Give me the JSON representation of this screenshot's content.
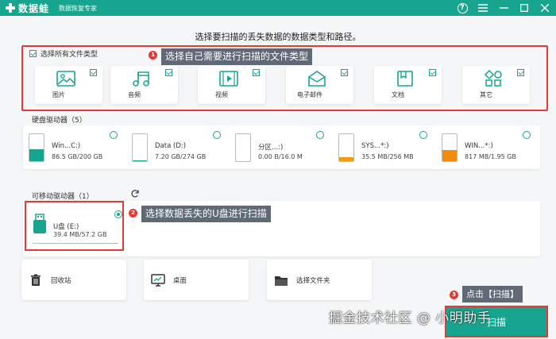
{
  "titlebar": {
    "app_name": "数据蛙",
    "subtitle": "数据恢复专家"
  },
  "headline": "选择要扫描的丢失数据的数据类型和路径。",
  "file_types": {
    "select_all": "选择所有文件类型",
    "items": [
      {
        "label": "图片",
        "icon": "image-icon",
        "checked": true
      },
      {
        "label": "音频",
        "icon": "music-icon",
        "checked": true
      },
      {
        "label": "视频",
        "icon": "video-icon",
        "checked": true
      },
      {
        "label": "电子邮件",
        "icon": "email-icon",
        "checked": true
      },
      {
        "label": "文档",
        "icon": "document-icon",
        "checked": true
      },
      {
        "label": "其它",
        "icon": "other-icon",
        "checked": true
      }
    ]
  },
  "annotations": [
    {
      "num": "1",
      "text": "选择自己需要进行扫描的文件类型"
    },
    {
      "num": "2",
      "text": "选择数据丢失的U盘进行扫描"
    },
    {
      "num": "3",
      "text": "点击【扫描】"
    }
  ],
  "hard_disks": {
    "title": "硬盘驱动器（5）",
    "items": [
      {
        "name": "Win...C:)",
        "size": "86.5 GB/200 GB",
        "fill_fraction": 0.43,
        "color": "#18a58f"
      },
      {
        "name": "Data (D:)",
        "size": "7.20 GB/274 GB",
        "fill_fraction": 0.03,
        "color": "#18a58f"
      },
      {
        "name": "分区...:)",
        "size": "0.00  B/16.0 M",
        "fill_fraction": 0.0,
        "color": "#18a58f"
      },
      {
        "name": "SYS...*:)",
        "size": "35.5 MB/256 MB",
        "fill_fraction": 0.14,
        "color": "#f39c12"
      },
      {
        "name": "WIN...*:)",
        "size": "817 MB/1.95 GB",
        "fill_fraction": 0.42,
        "color": "#f08a10"
      }
    ]
  },
  "removable": {
    "title": "可移动驱动器（1）",
    "item": {
      "name": "U盘 (E:)",
      "size": "39.4 MB/57.2 GB",
      "selected": true
    }
  },
  "locations": [
    {
      "label": "回收站",
      "icon": "recycle-bin-icon"
    },
    {
      "label": "桌面",
      "icon": "desktop-icon"
    },
    {
      "label": "选择文件夹",
      "icon": "folder-icon"
    }
  ],
  "scan_button": "扫描",
  "watermark": "掘金技术社区 @ 小明助手",
  "colors": {
    "accent": "#18a58f",
    "highlight": "#e53935",
    "callout": "#5f6a76"
  }
}
